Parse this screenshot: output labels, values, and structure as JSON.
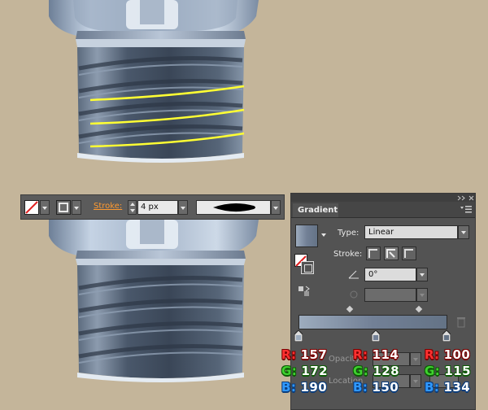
{
  "control_bar": {
    "stroke_label": "Stroke:",
    "stroke_value": "4 px"
  },
  "gradient_panel": {
    "tab_label": "Gradient",
    "type_label": "Type:",
    "type_value": "Linear",
    "stroke_label": "Stroke:",
    "angle_value": "0°",
    "opacity_label": "Opacity",
    "location_label": "Location",
    "stops": [
      {
        "color": "#9dacbe",
        "r": "157",
        "g": "172",
        "b": "190"
      },
      {
        "color": "#728096",
        "r": "114",
        "g": "128",
        "b": "150"
      },
      {
        "color": "#647386",
        "r": "100",
        "g": "115",
        "b": "134"
      }
    ]
  },
  "colors": {
    "background": "#c4b59a",
    "highlight_stroke": "#ffff33",
    "accent_label": "#ff9a30"
  }
}
